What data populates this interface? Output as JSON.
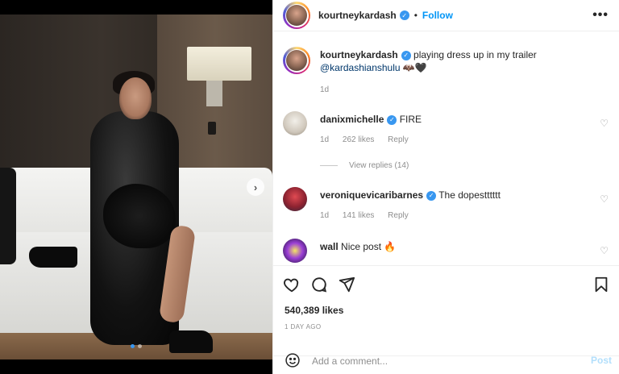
{
  "post": {
    "author": "kourtneykardash",
    "follow_label": "Follow",
    "separator": "•",
    "more_icon": "more-horizontal-icon",
    "caption": {
      "username": "kourtneykardash",
      "text": "playing dress up in my trailer",
      "mention": "@kardashianshulu",
      "emojis": "🦇🖤",
      "time": "1d"
    },
    "comments": [
      {
        "username": "danixmichelle",
        "text": "FIRE",
        "time": "1d",
        "likes": "262 likes",
        "reply_label": "Reply"
      },
      {
        "username": "veroniquevicaribarnes",
        "text": "The dopestttttt",
        "time": "1d",
        "likes": "141 likes",
        "reply_label": "Reply"
      },
      {
        "username": "wall",
        "text": "Nice post 🔥"
      }
    ],
    "view_replies": "View replies (14)",
    "likes_count": "540,389 likes",
    "timestamp": "1 DAY AGO",
    "add_comment_placeholder": "Add a comment...",
    "post_label": "Post",
    "carousel": {
      "total_slides": 2,
      "active_slide": 1
    },
    "colors": {
      "verified": "#3897f0",
      "follow": "#0095f6",
      "post_disabled": "#b2dffc"
    }
  }
}
